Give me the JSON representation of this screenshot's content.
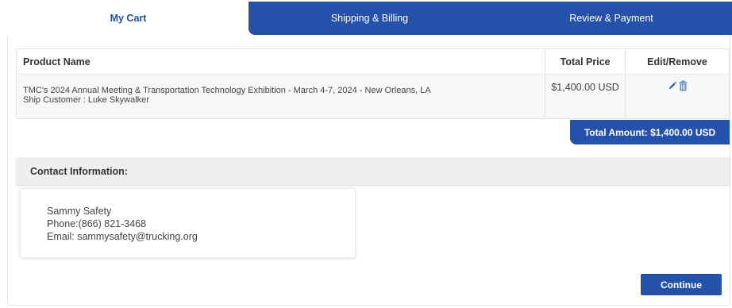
{
  "tabs": {
    "cart": "My Cart",
    "shipping": "Shipping & Billing",
    "review": "Review & Payment"
  },
  "table": {
    "headers": [
      "Product Name",
      "Total Price",
      "Edit/Remove"
    ],
    "rows": [
      {
        "product_line1": "TMC's 2024 Annual Meeting & Transportation Technology Exhibition - March 4-7, 2024 - New Orleans, LA",
        "product_line2": "Ship Customer : Luke Skywalker",
        "price": "$1,400.00 USD"
      }
    ]
  },
  "total": "Total Amount: $1,400.00 USD",
  "contact": {
    "header": "Contact Information:",
    "name": "Sammy Safety",
    "phone": "Phone:(866) 821-3468",
    "email": "Email: sammysafety@trucking.org"
  },
  "continue_label": "Continue",
  "colors": {
    "accent": "#2452ab",
    "active_tab_text": "#1f4fa8"
  },
  "icons": [
    "edit-pencil-icon",
    "trash-icon"
  ]
}
